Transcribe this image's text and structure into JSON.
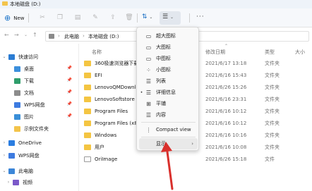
{
  "window": {
    "title": "本地磁盘 (D:)"
  },
  "toolbar": {
    "new_label": "New",
    "more_label": "···"
  },
  "address": {
    "crumbs": [
      "此电脑",
      "本地磁盘 (D:)"
    ]
  },
  "sidebar": {
    "items": [
      {
        "label": "快速访问",
        "icon": "star-icon",
        "color": "#2b7cd3",
        "expand": "⌄",
        "pinned": false,
        "selected": false
      },
      {
        "label": "桌面",
        "icon": "desktop-icon",
        "color": "#3c8fdc",
        "expand": "",
        "pinned": true,
        "selected": false
      },
      {
        "label": "下载",
        "icon": "download-icon",
        "color": "#2f9d6b",
        "expand": "",
        "pinned": true,
        "selected": false
      },
      {
        "label": "文档",
        "icon": "document-icon",
        "color": "#8c8c8c",
        "expand": "",
        "pinned": true,
        "selected": false
      },
      {
        "label": "WPS网盘",
        "icon": "cloud-drive-icon",
        "color": "#3d7be0",
        "expand": "",
        "pinned": true,
        "selected": false
      },
      {
        "label": "图片",
        "icon": "pictures-icon",
        "color": "#3a8fd8",
        "expand": "",
        "pinned": true,
        "selected": false
      },
      {
        "label": "示例文件夹",
        "icon": "folder-icon",
        "color": "#f3c44b",
        "expand": "",
        "pinned": false,
        "selected": false
      },
      {
        "label": "OneDrive",
        "icon": "onedrive-icon",
        "color": "#2a7de1",
        "expand": "›",
        "pinned": false,
        "selected": false
      },
      {
        "label": "WPS网盘",
        "icon": "cloud-drive-icon",
        "color": "#3d7be0",
        "expand": "›",
        "pinned": false,
        "selected": false
      },
      {
        "label": "此电脑",
        "icon": "this-pc-icon",
        "color": "#3b86d8",
        "expand": "⌄",
        "pinned": false,
        "selected": false
      },
      {
        "label": "视频",
        "icon": "video-icon",
        "color": "#7b59c9",
        "expand": "›",
        "pinned": false,
        "selected": false
      }
    ]
  },
  "columns": {
    "name": "名称",
    "date": "修改日期",
    "type": "类型",
    "size": "大小"
  },
  "files": [
    {
      "name": "360极速浏览器下载",
      "date": "2021/6/17 13:18",
      "type": "文件夹",
      "kind": "folder"
    },
    {
      "name": "EFI",
      "date": "2021/6/16 15:43",
      "type": "文件夹",
      "kind": "folder"
    },
    {
      "name": "LenovoQMDownload",
      "date": "2021/6/26 15:26",
      "type": "文件夹",
      "kind": "folder"
    },
    {
      "name": "LenovoSoftstore",
      "date": "2021/6/16 23:31",
      "type": "文件夹",
      "kind": "folder"
    },
    {
      "name": "Program Files",
      "date": "2021/6/16 10:12",
      "type": "文件夹",
      "kind": "folder"
    },
    {
      "name": "Program Files (x86)",
      "date": "2021/6/16 10:12",
      "type": "文件夹",
      "kind": "folder"
    },
    {
      "name": "Windows",
      "date": "2021/6/16 10:16",
      "type": "文件夹",
      "kind": "folder"
    },
    {
      "name": "用户",
      "date": "2021/6/16 10:08",
      "type": "文件夹",
      "kind": "folder"
    },
    {
      "name": "OriImage",
      "date": "2021/6/26 15:18",
      "type": "文件",
      "kind": "file"
    }
  ],
  "view_menu": {
    "items": [
      {
        "label": "超大图标",
        "icon": "extra-large-icons-icon",
        "glyph": "▭",
        "selected": false,
        "submenu": false
      },
      {
        "label": "大图标",
        "icon": "large-icons-icon",
        "glyph": "▭",
        "selected": false,
        "submenu": false
      },
      {
        "label": "中图标",
        "icon": "medium-icons-icon",
        "glyph": "▭",
        "selected": false,
        "submenu": false
      },
      {
        "label": "小图标",
        "icon": "small-icons-icon",
        "glyph": "⁘",
        "selected": false,
        "submenu": false
      },
      {
        "label": "列表",
        "icon": "list-icon",
        "glyph": "☰",
        "selected": false,
        "submenu": false
      },
      {
        "label": "详细信息",
        "icon": "details-icon",
        "glyph": "☰",
        "selected": true,
        "submenu": false
      },
      {
        "label": "平铺",
        "icon": "tiles-icon",
        "glyph": "⊞",
        "selected": false,
        "submenu": false
      },
      {
        "label": "内容",
        "icon": "content-icon",
        "glyph": "☰",
        "selected": false,
        "submenu": false
      },
      {
        "label": "Compact view",
        "icon": "compact-view-icon",
        "glyph": "⋮",
        "selected": false,
        "submenu": false
      },
      {
        "label": "显示",
        "icon": "",
        "glyph": "",
        "selected": false,
        "submenu": true
      }
    ],
    "submenu_arrow": "›",
    "selected_marker": "•"
  },
  "colors": {
    "accent": "#1a6fc4",
    "folder": "#f4c542",
    "annotation_arrow": "#d9302c"
  }
}
